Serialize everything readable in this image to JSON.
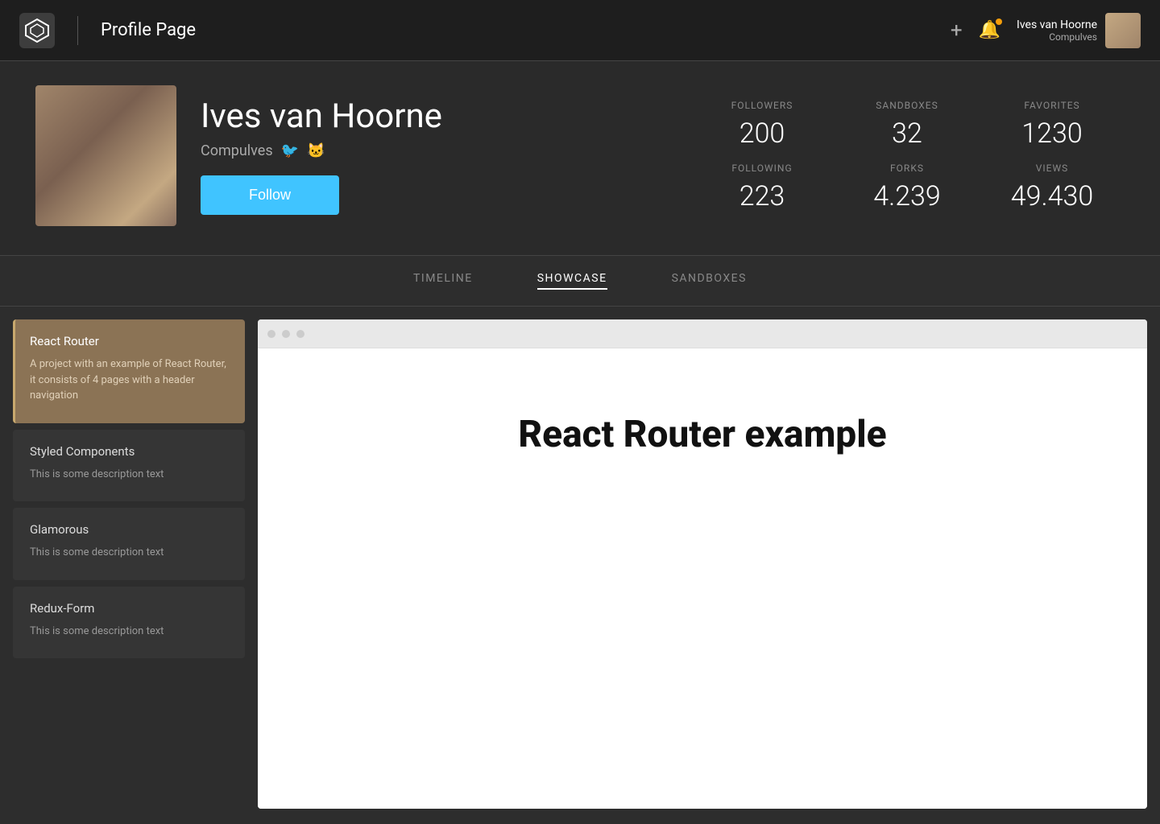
{
  "nav": {
    "title": "Profile Page",
    "plus_label": "+",
    "user": {
      "name": "Ives van Hoorne",
      "handle": "Compulves"
    }
  },
  "profile": {
    "name": "Ives van Hoorne",
    "handle": "Compulves",
    "follow_label": "Follow",
    "stats": {
      "followers_label": "FOLLOWERS",
      "followers_value": "200",
      "sandboxes_label": "SANDBOXES",
      "sandboxes_value": "32",
      "favorites_label": "FAVORITES",
      "favorites_value": "1230",
      "following_label": "FOLLOWING",
      "following_value": "223",
      "forks_label": "FORKS",
      "forks_value": "4.239",
      "views_label": "VIEWS",
      "views_value": "49.430"
    }
  },
  "tabs": [
    {
      "id": "timeline",
      "label": "TIMELINE",
      "active": false
    },
    {
      "id": "showcase",
      "label": "SHOWCASE",
      "active": true
    },
    {
      "id": "sandboxes",
      "label": "SANDBOXES",
      "active": false
    }
  ],
  "sidebar_items": [
    {
      "id": "react-router",
      "title": "React Router",
      "description": "A project with an example of React Router, it consists of 4 pages with a header navigation",
      "active": true
    },
    {
      "id": "styled-components",
      "title": "Styled Components",
      "description": "This is some description text",
      "active": false
    },
    {
      "id": "glamorous",
      "title": "Glamorous",
      "description": "This is some description text",
      "active": false
    },
    {
      "id": "redux-form",
      "title": "Redux-Form",
      "description": "This is some description text",
      "active": false
    }
  ],
  "preview": {
    "title": "React Router example"
  }
}
